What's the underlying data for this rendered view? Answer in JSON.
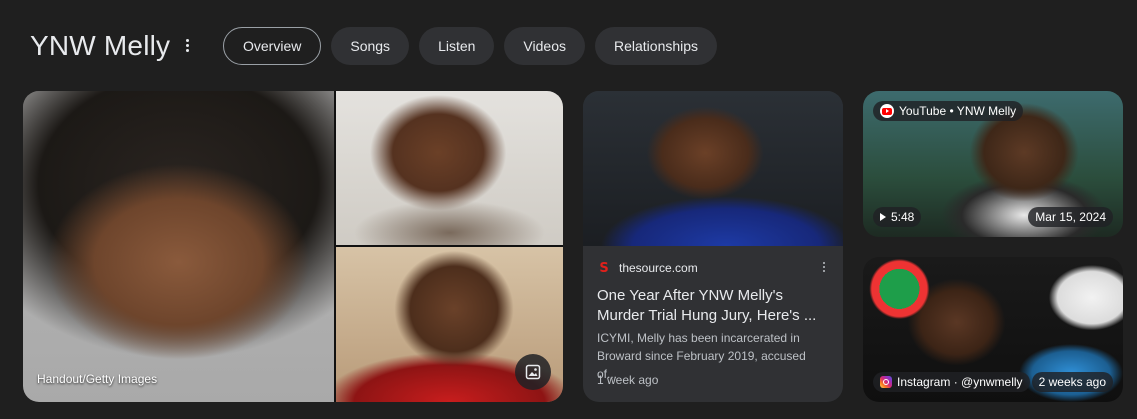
{
  "header": {
    "title": "YNW Melly",
    "tabs": [
      "Overview",
      "Songs",
      "Listen",
      "Videos",
      "Relationships"
    ],
    "active_tab": "Overview"
  },
  "collage": {
    "caption": "Handout/Getty Images",
    "expand_icon": "image-icon"
  },
  "article": {
    "source": "thesource.com",
    "title": "One Year After YNW Melly's Murder Trial Hung Jury, Here's ...",
    "snippet": "ICYMI, Melly has been incarcerated in Broward since February 2019, accused of...",
    "time": "1 week ago",
    "favicon_color": "#e0201b"
  },
  "video": {
    "source": "YouTube • YNW Melly",
    "duration": "5:48",
    "date": "Mar 15, 2024"
  },
  "instagram": {
    "source": "Instagram · @ynwmelly",
    "time": "2 weeks ago"
  },
  "colors": {
    "background": "#1f1f1f",
    "chip": "#303134",
    "text": "#e8eaed"
  }
}
